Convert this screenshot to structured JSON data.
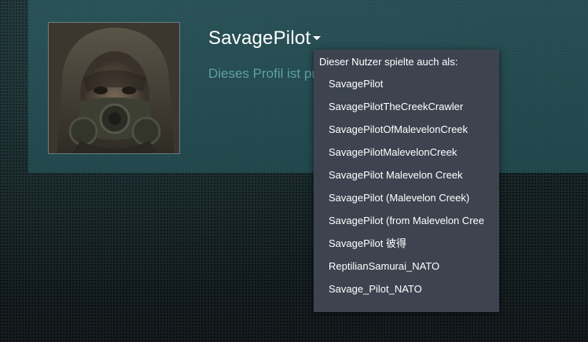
{
  "profile": {
    "persona_name": "SavagePilot",
    "privacy_text": "Dieses Profil ist privat.",
    "avatar_alt": "gas-mask avatar"
  },
  "alias_dropdown": {
    "title": "Dieser Nutzer spielte auch als:",
    "items": [
      "SavagePilot",
      "SavagePilotTheCreekCrawler",
      "SavagePilotOfMalevelonCreek",
      "SavagePilotMalevelonCreek",
      "SavagePilot Malevelon Creek",
      "SavagePilot (Malevelon Creek)",
      "SavagePilot (from Malevelon Cree",
      "SavagePilot 彼得",
      "ReptilianSamurai_NATO",
      "Savage_Pilot_NATO"
    ]
  },
  "colors": {
    "header_bg": "#2c5a60",
    "dropdown_bg": "#3d4450",
    "privacy_text": "#5e9fa6",
    "page_bg": "#14171a"
  },
  "icons": {
    "name_dropdown": "chevron-down-icon"
  }
}
